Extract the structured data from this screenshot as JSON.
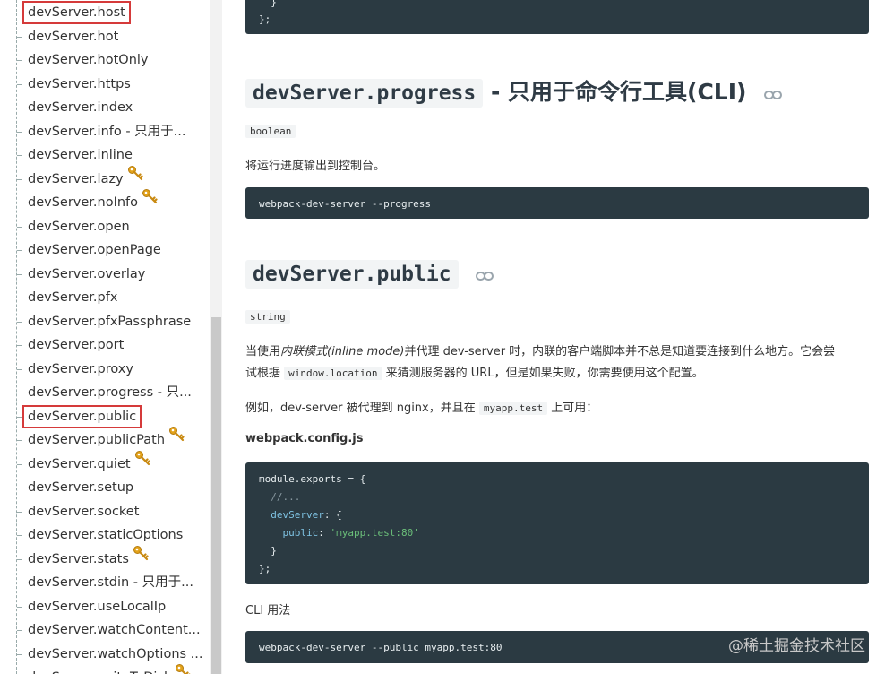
{
  "sidebar": {
    "items": [
      {
        "label": "devServer.host",
        "highlighted": true,
        "key": false
      },
      {
        "label": "devServer.hot",
        "highlighted": false,
        "key": false
      },
      {
        "label": "devServer.hotOnly",
        "highlighted": false,
        "key": false
      },
      {
        "label": "devServer.https",
        "highlighted": false,
        "key": false
      },
      {
        "label": "devServer.index",
        "highlighted": false,
        "key": false
      },
      {
        "label": "devServer.info - 只用于...",
        "highlighted": false,
        "key": false
      },
      {
        "label": "devServer.inline",
        "highlighted": false,
        "key": false
      },
      {
        "label": "devServer.lazy",
        "highlighted": false,
        "key": true
      },
      {
        "label": "devServer.noInfo",
        "highlighted": false,
        "key": true
      },
      {
        "label": "devServer.open",
        "highlighted": false,
        "key": false
      },
      {
        "label": "devServer.openPage",
        "highlighted": false,
        "key": false
      },
      {
        "label": "devServer.overlay",
        "highlighted": false,
        "key": false
      },
      {
        "label": "devServer.pfx",
        "highlighted": false,
        "key": false
      },
      {
        "label": "devServer.pfxPassphrase",
        "highlighted": false,
        "key": false
      },
      {
        "label": "devServer.port",
        "highlighted": false,
        "key": false
      },
      {
        "label": "devServer.proxy",
        "highlighted": false,
        "key": false
      },
      {
        "label": "devServer.progress - 只...",
        "highlighted": false,
        "key": false
      },
      {
        "label": "devServer.public",
        "highlighted": true,
        "key": false
      },
      {
        "label": "devServer.publicPath",
        "highlighted": false,
        "key": true
      },
      {
        "label": "devServer.quiet",
        "highlighted": false,
        "key": true
      },
      {
        "label": "devServer.setup",
        "highlighted": false,
        "key": false
      },
      {
        "label": "devServer.socket",
        "highlighted": false,
        "key": false
      },
      {
        "label": "devServer.staticOptions",
        "highlighted": false,
        "key": false
      },
      {
        "label": "devServer.stats",
        "highlighted": false,
        "key": true
      },
      {
        "label": "devServer.stdin - 只用于...",
        "highlighted": false,
        "key": false
      },
      {
        "label": "devServer.useLocalIp",
        "highlighted": false,
        "key": false
      },
      {
        "label": "devServer.watchContent...",
        "highlighted": false,
        "key": false
      },
      {
        "label": "devServer.watchOptions ...",
        "highlighted": false,
        "key": false
      },
      {
        "label": "devServer.writeToDisk",
        "highlighted": false,
        "key": true
      }
    ]
  },
  "main": {
    "top_code": [
      "  }",
      "};"
    ],
    "progress": {
      "heading_code": "devServer.progress",
      "heading_rest": " - 只用于命令行工具(CLI)",
      "type": "boolean",
      "desc": "将运行进度输出到控制台。",
      "cli": "webpack-dev-server --progress"
    },
    "public": {
      "heading_code": "devServer.public",
      "type": "string",
      "desc_1": "当使用",
      "desc_em": "内联模式(inline mode)",
      "desc_2": "并代理 dev-server 时，内联的客户端脚本并不总是知道要连接到什么地方。它会尝",
      "desc_3": "试根据",
      "desc_code": "window.location",
      "desc_4": "来猜测服务器的 URL，但是如果失败，你需要使用这个配置。",
      "example_1": "例如，dev-server 被代理到 nginx，并且在",
      "example_code": "myapp.test",
      "example_2": "上可用：",
      "config_file": "webpack.config.js",
      "config_code": {
        "line1": "module.exports = {",
        "line2": "  //...",
        "line3_key": "  devServer",
        "line3_rest": ": {",
        "line4_key": "    public",
        "line4_colon": ": ",
        "line4_str": "'myapp.test:80'",
        "line5": "  }",
        "line6": "};"
      },
      "cli_usage_label": "CLI 用法",
      "cli": "webpack-dev-server --public myapp.test:80"
    }
  },
  "watermark": "@稀土掘金技术社区",
  "colors": {
    "code_bg": "#2b3a42",
    "highlight_border": "#d53a3a",
    "key_icon": "#e3a21a"
  },
  "icons": {
    "key": "key-icon",
    "anchor": "link-icon"
  }
}
